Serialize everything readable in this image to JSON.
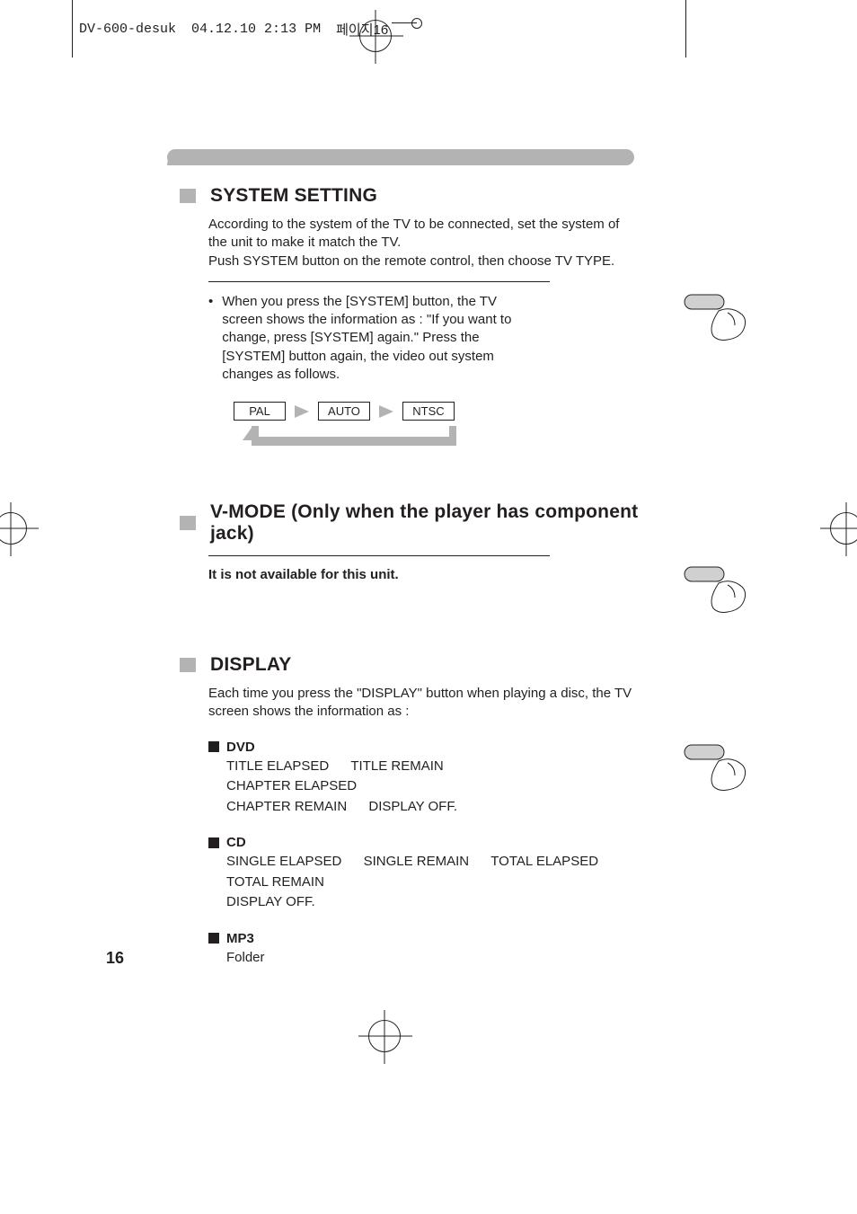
{
  "header": {
    "filename": "DV-600-desuk",
    "timestamp": "04.12.10 2:13 PM",
    "korean_suffix": "페이지16"
  },
  "section_system": {
    "title": "SYSTEM  SETTING",
    "para": "According to the system of the TV to be connected, set the system of the unit to make it match the TV.\nPush SYSTEM button on the remote control, then choose TV TYPE.",
    "bullet": "When you press the [SYSTEM] button, the TV screen shows the information as : \"If you want to change, press [SYSTEM] again.\" Press the [SYSTEM] button again, the video out system changes as follows.",
    "flow": {
      "a": "PAL",
      "b": "AUTO",
      "c": "NTSC"
    }
  },
  "section_vmode": {
    "title": "V-MODE (Only when the player has component jack)",
    "note": "It is not available for this unit."
  },
  "section_display": {
    "title": "DISPLAY",
    "para": "Each time you press the \"DISPLAY\" button when playing a disc, the TV screen shows the information as :",
    "dvd": {
      "label": "DVD",
      "l1a": "TITLE ELAPSED",
      "l1b": "TITLE REMAIN",
      "l1c": "CHAPTER ELAPSED",
      "l2a": "CHAPTER REMAIN",
      "l2b": "DISPLAY OFF."
    },
    "cd": {
      "label": "CD",
      "l1a": "SINGLE ELAPSED",
      "l1b": "SINGLE REMAIN",
      "l1c": "TOTAL ELAPSED",
      "l1d": "TOTAL REMAIN",
      "l2a": "DISPLAY OFF."
    },
    "mp3": {
      "label": "MP3",
      "body": "Folder"
    }
  },
  "page_number": "16"
}
